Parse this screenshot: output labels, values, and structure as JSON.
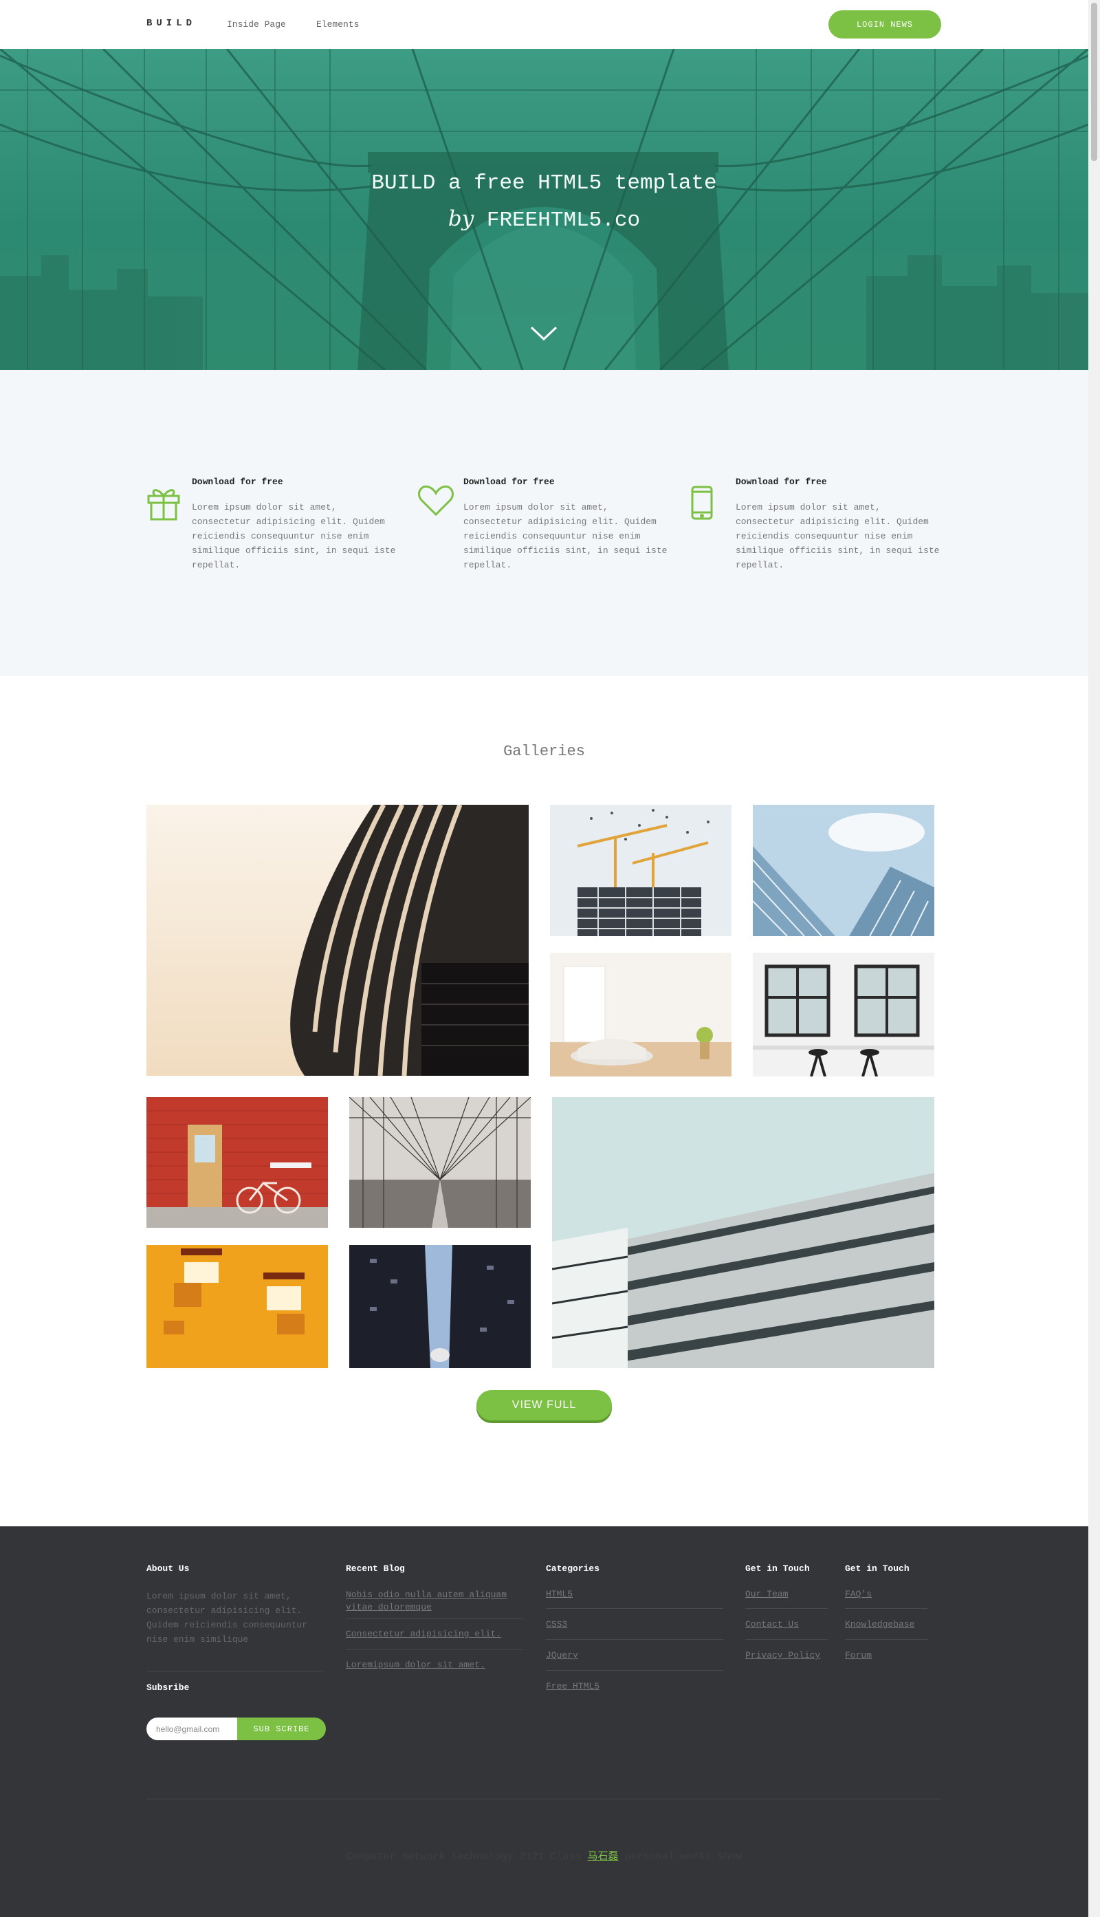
{
  "header": {
    "brand": "BUILD",
    "nav": [
      "Inside Page",
      "Elements"
    ],
    "login_label": "LOGIN NEWS"
  },
  "hero": {
    "title": "BUILD a free HTML5 template",
    "sub_by": "by",
    "sub_name": "FREEHTML5.co",
    "scroll_icon": "chevron-down-icon"
  },
  "features": [
    {
      "icon": "gift-icon",
      "title": "Download for free",
      "text": "Lorem ipsum dolor sit amet, consectetur adipisicing elit. Quidem reiciendis consequuntur nise enim similique officiis sint, in sequi iste repellat."
    },
    {
      "icon": "heart-icon",
      "title": "Download for free",
      "text": "Lorem ipsum dolor sit amet, consectetur adipisicing elit. Quidem reiciendis consequuntur nise enim similique officiis sint, in sequi iste repellat."
    },
    {
      "icon": "mobile-icon",
      "title": "Download for free",
      "text": "Lorem ipsum dolor sit amet, consectetur adipisicing elit. Quidem reiciendis consequuntur nise enim similique officiis sint, in sequi iste repellat."
    }
  ],
  "gallery": {
    "title": "Galleries",
    "view_full_label": "VIEW FULL"
  },
  "footer": {
    "about": {
      "title": "About Us",
      "text": "Lorem ipsum dolor sit amet, consectetur adipisicing elit. Quidem reiciendis consequuntur nise enim similique"
    },
    "subscribe": {
      "title": "Subsribe",
      "placeholder": "hello@gmail.com",
      "button": "SUB SCRIBE"
    },
    "recent_blog": {
      "title": "Recent Blog",
      "links": [
        "Nobis odio nulla autem aliquam vitae doloremque",
        "Consectetur adipisicing elit.",
        "Loremipsum dolor sit amet."
      ]
    },
    "categories": {
      "title": "Categories",
      "links": [
        "HTML5",
        "CSS3",
        "JQuery",
        "Free HTML5"
      ]
    },
    "get_in_touch_1": {
      "title": "Get in Touch",
      "links": [
        "Our Team",
        "Contact Us",
        "Privacy Policy"
      ]
    },
    "get_in_touch_2": {
      "title": "Get in Touch",
      "links": [
        "FAQ's",
        "Knowledgebase",
        "Forum"
      ]
    },
    "copyright_before": "Computer network technology 2121 Class ",
    "copyright_link": "马石磊",
    "copyright_after": " personal works show"
  },
  "colors": {
    "accent_green": "#7cc044",
    "hero_teal": "#2f8b6e",
    "footer_dark": "#333538",
    "feature_bg": "#f4f7f9"
  }
}
